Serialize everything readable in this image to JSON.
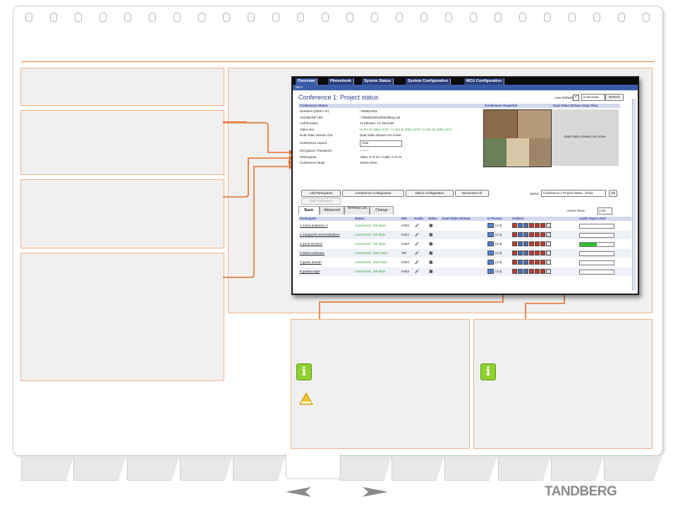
{
  "screenshot": {
    "nav_tabs": [
      "Overview",
      "Phonebook",
      "System Status",
      "System Configuration",
      "MCU Configuration"
    ],
    "sub_nav": "MCU",
    "title": "Conference 1: Project status",
    "auto_refresh_label": "Auto Refresh:",
    "refresh_interval": "5 Seconds",
    "refresh_button": "Refresh",
    "status_header": "Conference Status",
    "snapshot_header": "Conference Snapshot",
    "dual_snapshot_header": "Dual Video Stream Snap Shot",
    "dual_not_active": "Dual Video Stream not Active",
    "status_rows": [
      {
        "label": "Numbers (ISDN / IP)",
        "value": "/ 583821601",
        "color": "#222222"
      },
      {
        "label": "H323ID/SIP URI",
        "value": "/ 7583821601@tandberg.net",
        "color": "#222222"
      },
      {
        "label": "Call Duration",
        "value": "41 Minutes, 13 Seconds",
        "color": "#222222"
      },
      {
        "label": "Video Out",
        "value": "H.264 @ 30fps 4CIF / H.263 @ 30fps 4CIF / H.261 @ 30fps 4CIF",
        "color": "#3aa43a"
      },
      {
        "label": "Dual Video Stream Out",
        "value": "Dual Video Stream not Active",
        "color": "#222222"
      },
      {
        "label": "Conference Layout",
        "value": "Auto",
        "color": "#222222"
      },
      {
        "label": "Encryption / Password",
        "value": "— / —",
        "color": "#222222"
      },
      {
        "label": "Participants",
        "value": "Video: 6 of 10  / Audio: 0 of 10",
        "color": "#222222"
      },
      {
        "label": "Conference Mode",
        "value": "Stand Alone",
        "color": "#222222"
      }
    ],
    "buttons": [
      "Add Participants",
      "Conference Configuration",
      "Dial-in Configuration",
      "Disconnect All"
    ],
    "end_conference": "End Conference",
    "select_label": "Select:",
    "select_value": "Conference 1 Project status : Show",
    "ok_button": "Ok",
    "inner_tabs": [
      "Basic",
      "Advanced",
      "Terminal List",
      "Change"
    ],
    "active_label": "Active",
    "show_label": "Show",
    "show_value": "1-40",
    "columns": [
      "Participant",
      "Status",
      "Net",
      "Audio",
      "Video",
      "Dual Video Stream",
      "In Picture",
      "Actions",
      "Audio Input Level"
    ],
    "participants": [
      {
        "name": "1 mona.andersen 3",
        "status": "Connected, 768 kbps",
        "net": "H323",
        "pic": "(4:3)",
        "level": 0
      },
      {
        "name": "2 margareth.wennesbakken",
        "status": "Connected, 768 kbps",
        "net": "H323",
        "pic": "(4:3)",
        "level": 0
      },
      {
        "name": "3 arme.ovrebos",
        "status": "Connected, 768 kbps",
        "net": "H323",
        "pic": "(4:3)",
        "level": 0.5
      },
      {
        "name": "4 Marit.Andresen",
        "status": "Connected, 1920 kbps",
        "net": "SIP",
        "pic": "(4:3)",
        "level": 0
      },
      {
        "name": "5 gaute.ahrsah",
        "status": "Connected, 1920 kbps",
        "net": "H323",
        "pic": "(4:3)",
        "level": 0
      },
      {
        "name": "6 gustav.vage",
        "status": "Connected, 768 kbps",
        "net": "H323",
        "pic": "(4:3)",
        "level": 0
      }
    ]
  },
  "logo": "TANDBERG",
  "colors": {
    "accent": "#e56f26",
    "tab_blue": "#2a3f7a",
    "connected": "#3aa43a"
  },
  "icons": [
    "info-icon",
    "warning-icon",
    "back-arrow-icon",
    "forward-arrow-icon"
  ]
}
